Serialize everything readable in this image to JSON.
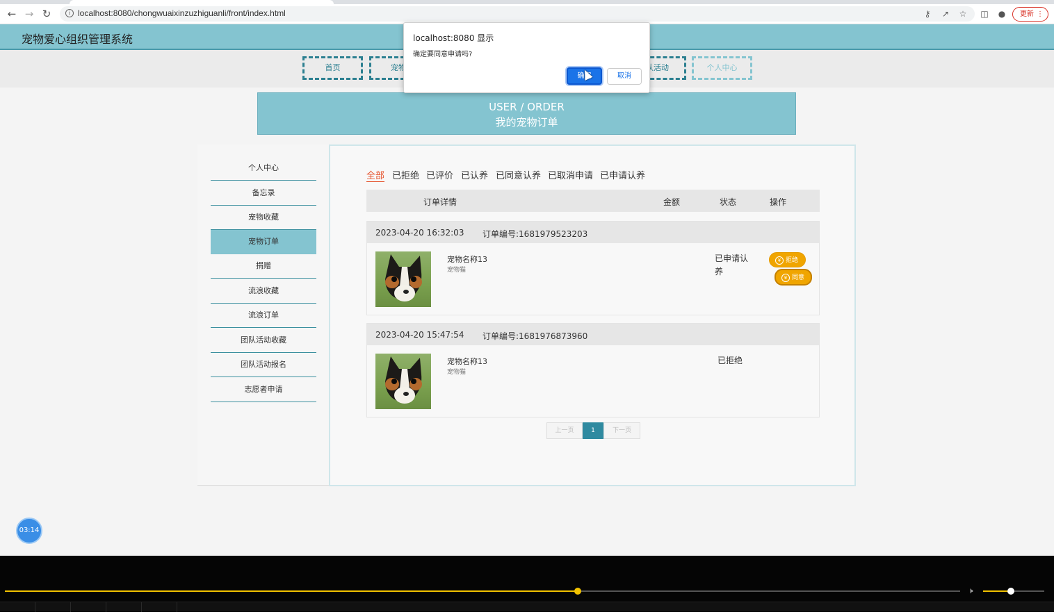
{
  "browser": {
    "url": "localhost:8080/chongwuaixinzuzhiguanli/front/index.html",
    "update_label": "更新"
  },
  "site": {
    "title": "宠物爱心组织管理系统",
    "menu": [
      "首页",
      "宠物",
      "队活动",
      "个人中心"
    ]
  },
  "banner": {
    "en": "USER / ORDER",
    "cn": "我的宠物订单"
  },
  "sidebar": {
    "items": [
      {
        "label": "个人中心"
      },
      {
        "label": "备忘录"
      },
      {
        "label": "宠物收藏"
      },
      {
        "label": "宠物订单",
        "active": true
      },
      {
        "label": "捐赠"
      },
      {
        "label": "流浪收藏"
      },
      {
        "label": "流浪订单"
      },
      {
        "label": "团队活动收藏"
      },
      {
        "label": "团队活动报名"
      },
      {
        "label": "志愿者申请"
      }
    ]
  },
  "filters": [
    "全部",
    "已拒绝",
    "已评价",
    "已认养",
    "已同意认养",
    "已取消申请",
    "已申请认养"
  ],
  "table_header": {
    "detail": "订单详情",
    "amount": "金额",
    "status": "状态",
    "action": "操作"
  },
  "orders": [
    {
      "time": "2023-04-20 16:32:03",
      "order_no": "订单编号:1681979523203",
      "pet_name": "宠物名称13",
      "pet_type": "宠物猫",
      "status": "已申请认养",
      "actions": [
        "拒绝",
        "同意"
      ]
    },
    {
      "time": "2023-04-20 15:47:54",
      "order_no": "订单编号:1681976873960",
      "pet_name": "宠物名称13",
      "pet_type": "宠物猫",
      "status": "已拒绝",
      "actions": []
    }
  ],
  "pager": {
    "prev": "上一页",
    "current": "1",
    "next": "下一页"
  },
  "dialog": {
    "title": "localhost:8080 显示",
    "message": "确定要同意申请吗?",
    "ok": "确定",
    "cancel": "取消"
  },
  "timer": "03:14",
  "player": {
    "progress": 0.6,
    "volume": 0.45
  },
  "colors": {
    "accent": "#84c4d0",
    "dark_accent": "#2b7f90",
    "action_pill": "#f0a500",
    "active_filter": "#e5532d"
  }
}
